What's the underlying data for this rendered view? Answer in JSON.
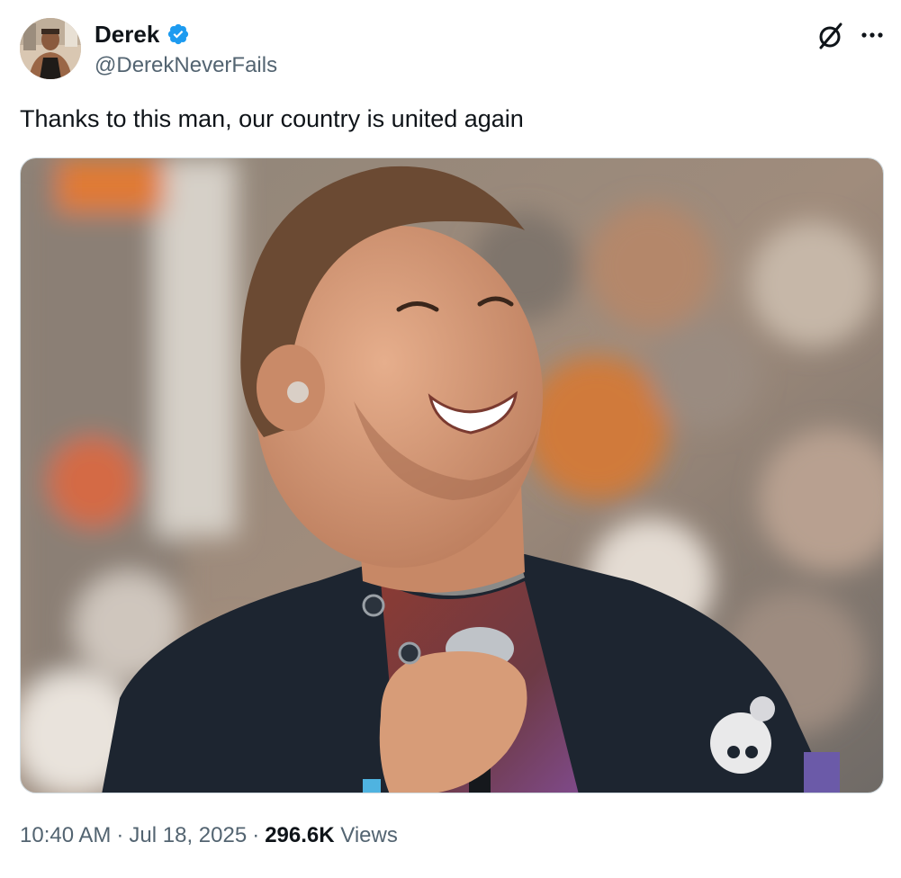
{
  "author": {
    "display_name": "Derek",
    "handle": "@DerekNeverFails",
    "verified": true,
    "verified_color": "#1d9bf0"
  },
  "icons": {
    "grok": "grok-icon",
    "more": "more-options-icon"
  },
  "tweet": {
    "text": "Thanks to this man, our country is united again"
  },
  "media": {
    "type": "photo"
  },
  "meta": {
    "time": "10:40 AM",
    "separator": "·",
    "date": "Jul 18, 2025",
    "views_count": "296.6K",
    "views_label": "Views"
  }
}
